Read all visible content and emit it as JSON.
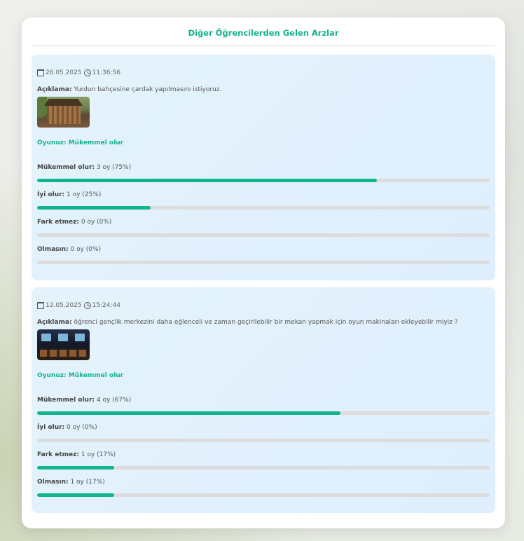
{
  "modal": {
    "title": "Diğer Öğrencilerden Gelen Arzlar"
  },
  "labels": {
    "description": "Açıklama:",
    "vote": "Oyunuz:"
  },
  "colors": {
    "accent": "#12b48c",
    "track": "#dcdcdc"
  },
  "requests": [
    {
      "date": "26.05.2025",
      "time": "11:36:56",
      "description": "Yurdun bahçesine çardak yapılmasını istiyoruz.",
      "image": "gazebo-photo",
      "your_vote": "Mükemmel olur",
      "options": [
        {
          "label": "Mükemmel olur:",
          "text": "3 oy (75%)",
          "percent": 75
        },
        {
          "label": "İyi olur:",
          "text": "1 oy (25%)",
          "percent": 25
        },
        {
          "label": "Fark etmez:",
          "text": "0 oy (0%)",
          "percent": 0
        },
        {
          "label": "Olmasın:",
          "text": "0 oy (0%)",
          "percent": 0
        }
      ]
    },
    {
      "date": "12.05.2025",
      "time": "15:24:44",
      "description": "öğrenci gençlik merkezini daha eğlenceli ve zaman geçirilebilir bir mekan yapmak için oyun makinaları ekleyebilir miyiz ?",
      "image": "arcade-room-photo",
      "your_vote": "Mükemmel olur",
      "options": [
        {
          "label": "Mükemmel olur:",
          "text": "4 oy (67%)",
          "percent": 67
        },
        {
          "label": "İyi olur:",
          "text": "0 oy (0%)",
          "percent": 0
        },
        {
          "label": "Fark etmez:",
          "text": "1 oy (17%)",
          "percent": 17
        },
        {
          "label": "Olmasın:",
          "text": "1 oy (17%)",
          "percent": 17
        }
      ]
    }
  ]
}
